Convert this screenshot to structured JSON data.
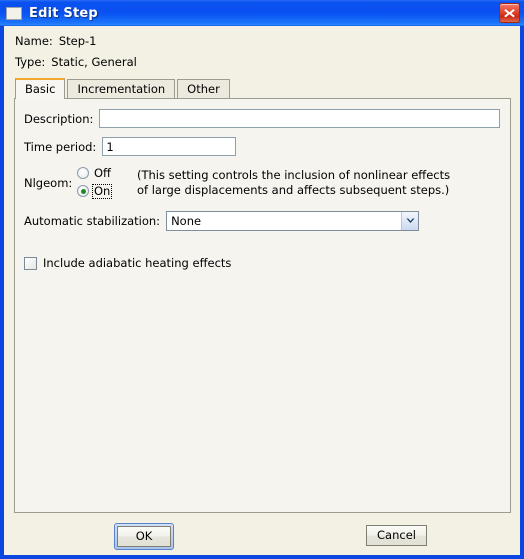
{
  "window": {
    "title": "Edit Step",
    "title_icon": "window-icon",
    "close_icon": "close-icon",
    "accent_blue": "#0b4ff0",
    "close_red": "#c92a14",
    "client_bg": "#f2f1e4",
    "panel_bg": "#f5f4ef",
    "tab_accent": "#f0a830"
  },
  "meta": {
    "name_label": "Name:",
    "name_value": "Step-1",
    "type_label": "Type:",
    "type_value": "Static, General"
  },
  "tabs": [
    {
      "label": "Basic",
      "active": true
    },
    {
      "label": "Incrementation",
      "active": false
    },
    {
      "label": "Other",
      "active": false
    }
  ],
  "basic": {
    "description_label": "Description:",
    "description_value": "",
    "description_placeholder": "",
    "time_period_label": "Time period:",
    "time_period_value": "1",
    "nlgeom_label": "Nlgeom:",
    "nlgeom_off_label": "Off",
    "nlgeom_on_label": "On",
    "nlgeom_selected": "On",
    "nlgeom_hint_line1": "(This setting controls the inclusion of nonlinear effects",
    "nlgeom_hint_line2": "of large displacements and affects subsequent steps.)",
    "stabilization_label": "Automatic stabilization:",
    "stabilization_value": "None",
    "stabilization_options": [
      "None"
    ],
    "adiabatic_label": "Include adiabatic heating effects",
    "adiabatic_checked": false
  },
  "footer": {
    "ok_label": "OK",
    "cancel_label": "Cancel"
  }
}
